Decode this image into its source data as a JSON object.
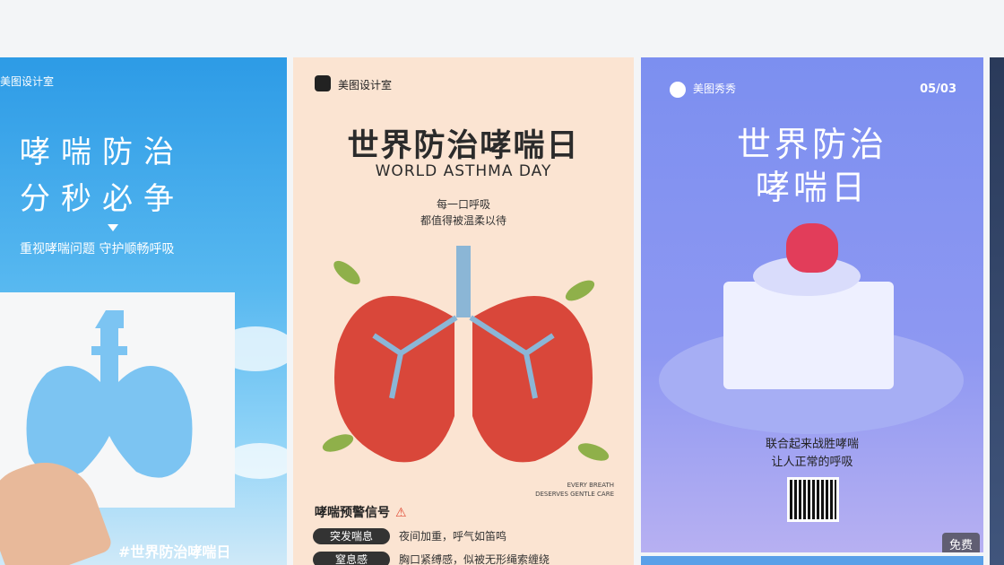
{
  "card1": {
    "brand": "美图设计室",
    "title_line1": "哮喘防治",
    "title_line2": "分秒必争",
    "subtitle": "重视哮喘问题 守护顺畅呼吸",
    "hashtag": "#世界防治哮喘日"
  },
  "card2": {
    "brand": "美图设计室",
    "title": "世界防治哮喘日",
    "english": "WORLD ASTHMA DAY",
    "quote_line1": "每一口呼吸",
    "quote_line2": "都值得被温柔以待",
    "small_line1": "EVERY BREATH",
    "small_line2": "DESERVES GENTLE CARE",
    "warning_title": "哮喘预警信号",
    "signals": [
      {
        "label": "突发喘息",
        "text": "夜间加重，呼气如笛鸣"
      },
      {
        "label": "窒息感",
        "text": "胸口紧缚感，似被无形绳索缠绕"
      }
    ]
  },
  "card3": {
    "brand": "美图秀秀",
    "date": "05/03",
    "title_line1": "世界防治",
    "title_line2": "哮喘日",
    "slogan_line1": "联合起来战胜哮喘",
    "slogan_line2": "让人正常的呼吸",
    "badge": "免费"
  },
  "colors": {
    "card1_bg": "#2d9be6",
    "card2_bg": "#fbe4d2",
    "card3_bg": "#7c8ff0",
    "lung_red": "#e23d5a"
  }
}
